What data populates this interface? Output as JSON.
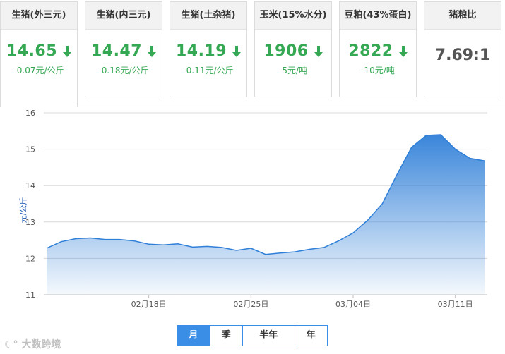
{
  "cards": [
    {
      "name": "生猪(外三元)",
      "price": "14.65",
      "change": "-0.07元/公斤",
      "direction": "down"
    },
    {
      "name": "生猪(内三元)",
      "price": "14.47",
      "change": "-0.18元/公斤",
      "direction": "down"
    },
    {
      "name": "生猪(土杂猪)",
      "price": "14.19",
      "change": "-0.11元/公斤",
      "direction": "down"
    },
    {
      "name": "玉米(15%水分)",
      "price": "1906",
      "change": "-5元/吨",
      "direction": "down"
    },
    {
      "name": "豆粕(43%蛋白)",
      "price": "2822",
      "change": "-10元/吨",
      "direction": "down"
    }
  ],
  "ratio_card": {
    "name": "猪粮比",
    "value": "7.69:1"
  },
  "colors": {
    "down": "#34a853",
    "line": "#2f7fd8",
    "accent": "#3a8ee6"
  },
  "chart_data": {
    "type": "area",
    "ylabel": "元/公斤",
    "ylim": [
      11,
      16
    ],
    "yticks": [
      11,
      12,
      13,
      14,
      15,
      16
    ],
    "x_tick_labels": [
      "02月18日",
      "02月25日",
      "03月04日",
      "03月11日"
    ],
    "x_tick_index": [
      7,
      14,
      21,
      28
    ],
    "values": [
      12.28,
      12.46,
      12.54,
      12.56,
      12.52,
      12.52,
      12.48,
      12.39,
      12.37,
      12.4,
      12.31,
      12.33,
      12.3,
      12.22,
      12.28,
      12.11,
      12.15,
      12.18,
      12.25,
      12.3,
      12.48,
      12.7,
      13.05,
      13.5,
      14.3,
      15.05,
      15.38,
      15.4,
      15.0,
      14.75,
      14.68
    ],
    "grid": true,
    "legend": "none"
  },
  "ranges": [
    {
      "label": "月",
      "selected": true
    },
    {
      "label": "季",
      "selected": false
    },
    {
      "label": "半年",
      "selected": false
    },
    {
      "label": "年",
      "selected": false
    }
  ],
  "watermark": "大数跨境"
}
